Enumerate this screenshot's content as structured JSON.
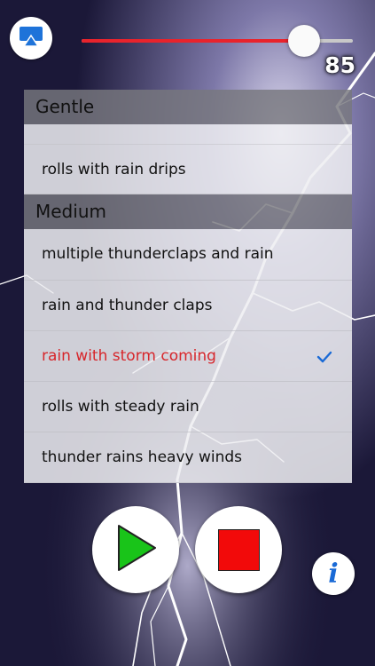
{
  "icons": {
    "airplay": "airplay-icon",
    "check": "checkmark-icon",
    "play": "play-icon",
    "stop": "stop-icon",
    "info": "info-icon"
  },
  "colors": {
    "slider_fill": "#e8232c",
    "selected_text": "#d7262b",
    "check": "#1a6ad6",
    "play": "#19c419",
    "stop": "#f20a0a",
    "info": "#1a6ad6"
  },
  "volume": {
    "value": "85",
    "fraction": 0.82
  },
  "sections": [
    {
      "title": "Gentle",
      "items": [
        "rolls with rain drips"
      ]
    },
    {
      "title": "Medium",
      "items": [
        "multiple thunderclaps and rain",
        "rain and thunder claps",
        "rain with storm coming",
        "rolls with steady rain",
        "thunder rains heavy winds"
      ]
    }
  ],
  "selected_item": "rain with storm coming",
  "controls": {
    "info_glyph": "i"
  }
}
